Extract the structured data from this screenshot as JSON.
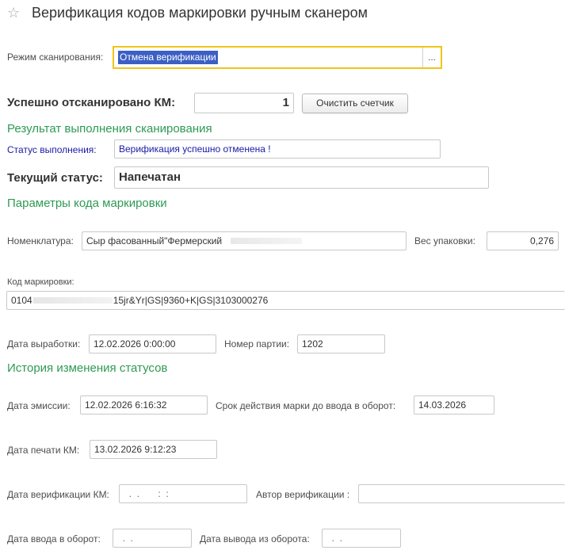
{
  "header": {
    "title": "Верификация кодов маркировки ручным сканером"
  },
  "scan_mode": {
    "label": "Режим сканирования:",
    "value": "Отмена верификации",
    "choose_button": "..."
  },
  "counter": {
    "label": "Успешно отсканировано КМ:",
    "value": "1",
    "clear_button": "Очистить счетчик"
  },
  "result_section": {
    "title": "Результат выполнения сканирования",
    "status_label": "Статус выполнения:",
    "status_value": "Верификация успешно отменена !"
  },
  "current_status": {
    "label": "Текущий статус:",
    "value": "Напечатан"
  },
  "params_section": {
    "title": "Параметры кода маркировки",
    "nomenclature_label": "Номенклатура:",
    "nomenclature_value": "Сыр фасованный\"Фермерский",
    "weight_label": "Вес упаковки:",
    "weight_value": "0,276",
    "code_label": "Код маркировки:",
    "code_value_prefix": "0104",
    "code_value_suffix": "15jr&Yr|GS|9360+K|GS|3103000276",
    "production_date_label": "Дата выработки:",
    "production_date_value": "12.02.2026  0:00:00",
    "batch_label": "Номер партии:",
    "batch_value": "1202"
  },
  "history_section": {
    "title": "История изменения статусов",
    "emission_label": "Дата эмиссии:",
    "emission_value": "12.02.2026  6:16:32",
    "validity_label": "Срок действия марки до ввода в оборот:",
    "validity_value": "14.03.2026",
    "print_label": "Дата печати КМ:",
    "print_value": "13.02.2026  9:12:23",
    "verification_date_label": "Дата верификации КМ:",
    "verification_date_value": "  .  .       :  :",
    "verification_author_label": "Автор верификации :",
    "verification_author_value": "",
    "circulation_in_label": "Дата ввода в оборот:",
    "circulation_in_value": "  .  .",
    "circulation_out_label": "Дата вывода из оборота:",
    "circulation_out_value": "  .  ."
  },
  "colors": {
    "section_title": "#2e9a54",
    "status_text": "#1a1aa6",
    "focus_border": "#f0c419",
    "selection_bg": "#3b5fc4"
  },
  "icons": {
    "favorite": "star-icon"
  }
}
